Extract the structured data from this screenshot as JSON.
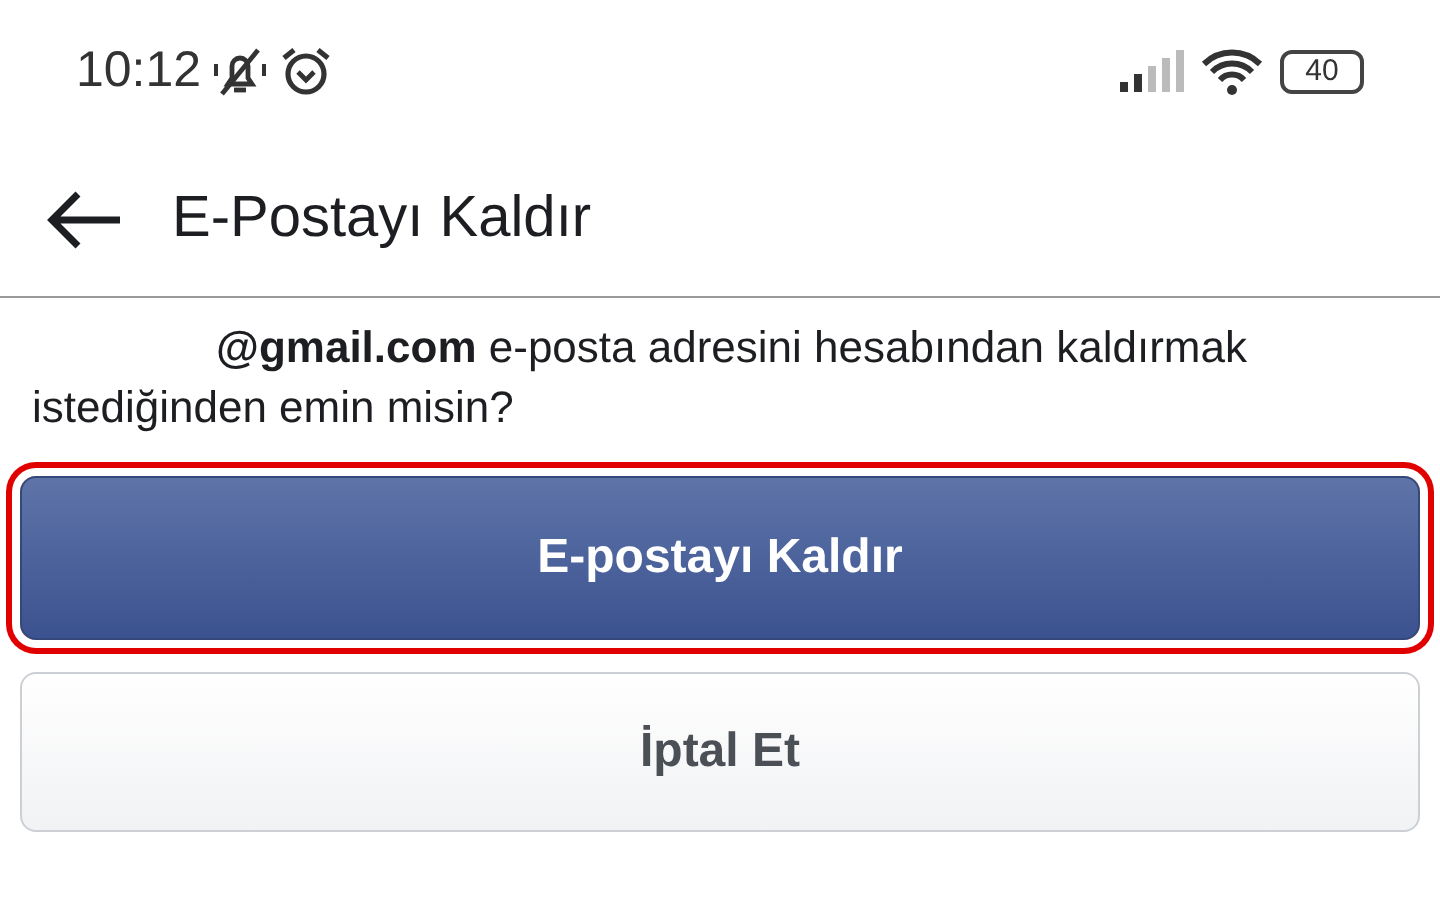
{
  "status_bar": {
    "time": "10:12",
    "battery": "40"
  },
  "header": {
    "title": "E-Postayı Kaldır"
  },
  "message": "**@gmail.com** e-posta adresini hesabından kaldırmak istediğinden emin misin?",
  "buttons": [
    {
      "label": "E-postayı Kaldır",
      "kind": "primary",
      "highlighted": true
    },
    {
      "label": "İptal Et",
      "kind": "secondary",
      "highlighted": false
    }
  ]
}
